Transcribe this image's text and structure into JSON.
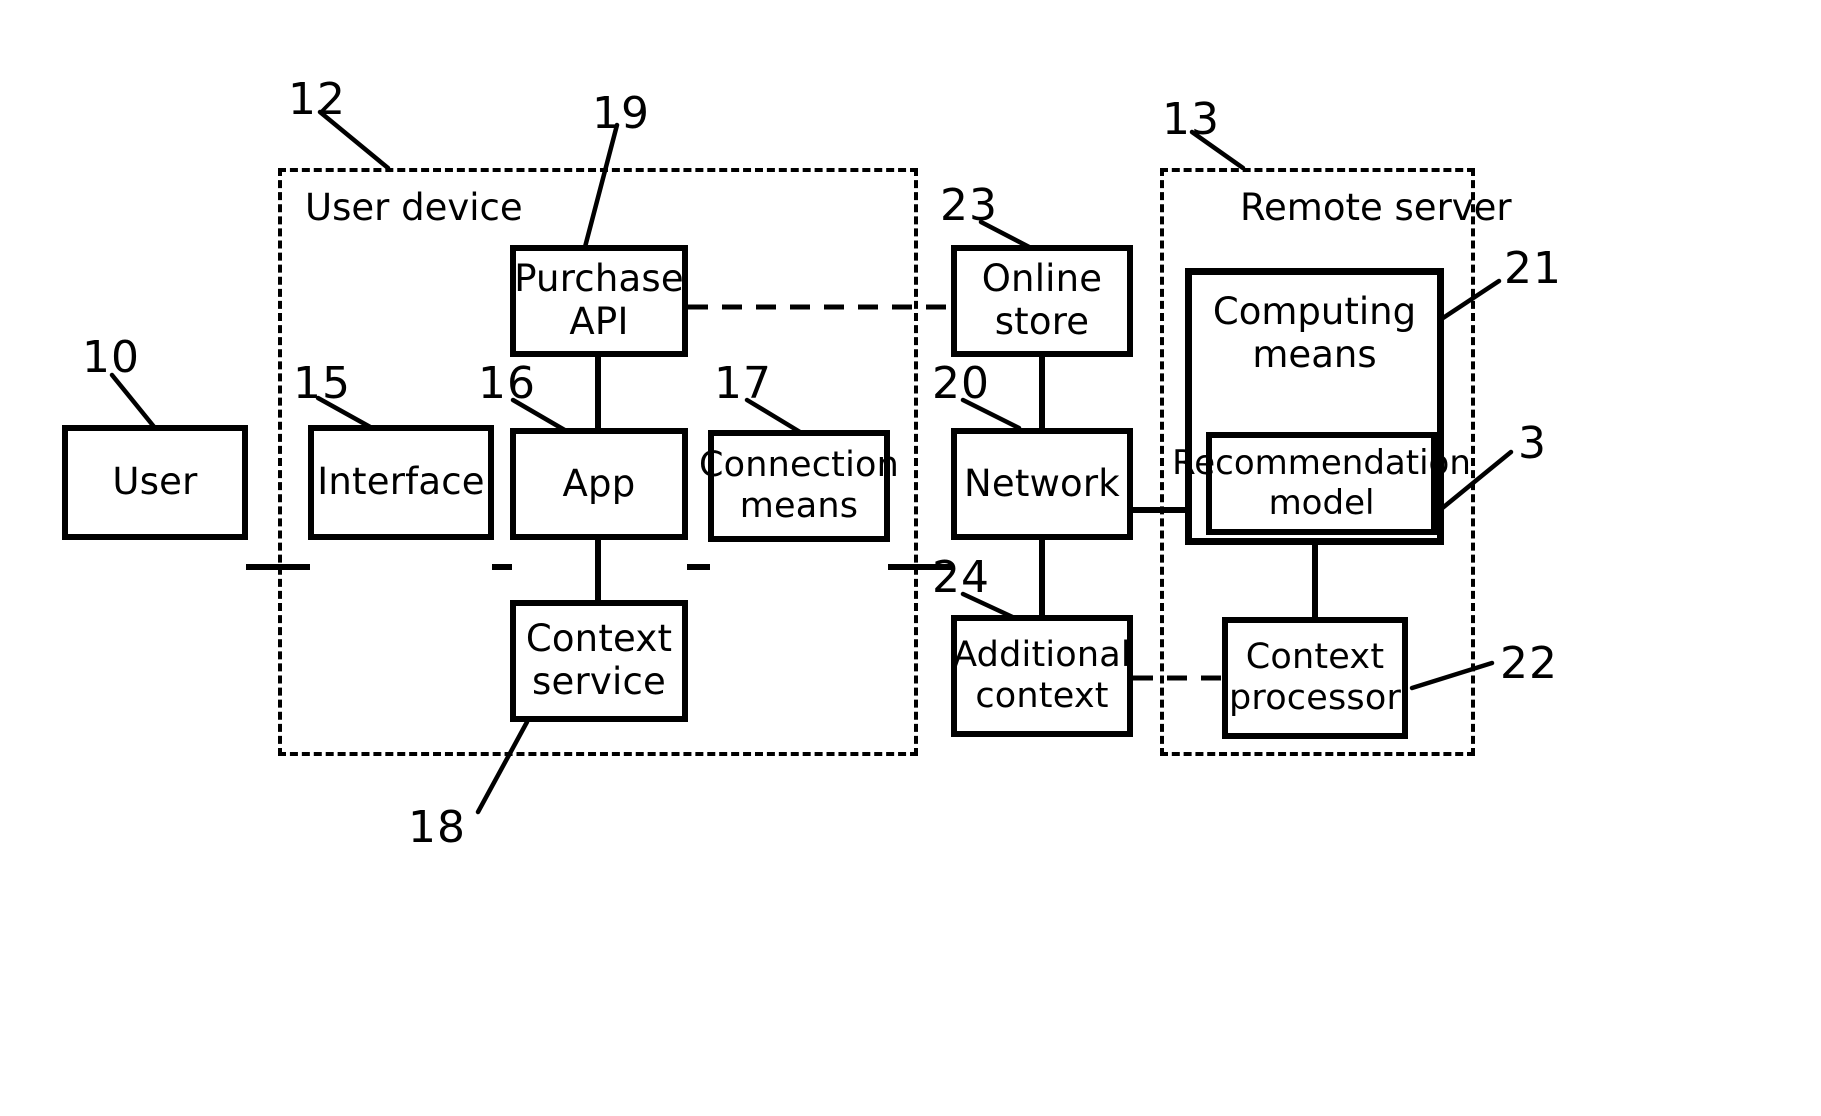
{
  "figure": {
    "type": "patent-block-diagram",
    "description": "Recommendation system block diagram with user device and remote server"
  },
  "groups": [
    {
      "id": "user-device",
      "label": "User device",
      "ref": "12"
    },
    {
      "id": "remote-server",
      "label": "Remote server",
      "ref": "13"
    }
  ],
  "blocks": [
    {
      "id": "user",
      "label": "User",
      "ref": "10"
    },
    {
      "id": "interface",
      "label": "Interface",
      "ref": "15"
    },
    {
      "id": "app",
      "label": "App",
      "ref": "16"
    },
    {
      "id": "purchase-api",
      "label_line1": "Purchase",
      "label_line2": "API",
      "ref": "19"
    },
    {
      "id": "connection-means",
      "label_line1": "Connection",
      "label_line2": "means",
      "ref": "17"
    },
    {
      "id": "context-service",
      "label_line1": "Context",
      "label_line2": "service",
      "ref": "18"
    },
    {
      "id": "online-store",
      "label_line1": "Online",
      "label_line2": "store",
      "ref": "23"
    },
    {
      "id": "network",
      "label": "Network",
      "ref": "20"
    },
    {
      "id": "additional-context",
      "label_line1": "Additional",
      "label_line2": "context",
      "ref": "24"
    },
    {
      "id": "computing-means",
      "label_line1": "Computing",
      "label_line2": "means",
      "ref": "21"
    },
    {
      "id": "recommendation-model",
      "label_line1": "Recommendation",
      "label_line2": "model",
      "ref": "3"
    },
    {
      "id": "context-processor",
      "label_line1": "Context",
      "label_line2": "processor",
      "ref": "22"
    }
  ],
  "labels": {
    "user": "User",
    "interface": "Interface",
    "app": "App",
    "purchase_api_l1": "Purchase",
    "purchase_api_l2": "API",
    "connection_means_l1": "Connection",
    "connection_means_l2": "means",
    "context_service_l1": "Context",
    "context_service_l2": "service",
    "online_store_l1": "Online",
    "online_store_l2": "store",
    "network": "Network",
    "additional_context_l1": "Additional",
    "additional_context_l2": "context",
    "computing_means_l1": "Computing",
    "computing_means_l2": "means",
    "recommendation_model_l1": "Recommendation",
    "recommendation_model_l2": "model",
    "context_processor_l1": "Context",
    "context_processor_l2": "processor",
    "user_device_group": "User device",
    "remote_server_group": "Remote server"
  },
  "refnums": {
    "n10": "10",
    "n12": "12",
    "n13": "13",
    "n15": "15",
    "n16": "16",
    "n17": "17",
    "n18": "18",
    "n19": "19",
    "n20": "20",
    "n21": "21",
    "n22": "22",
    "n23": "23",
    "n24": "24",
    "n3": "3"
  },
  "colors": {
    "line": "#000000",
    "background": "#ffffff"
  }
}
